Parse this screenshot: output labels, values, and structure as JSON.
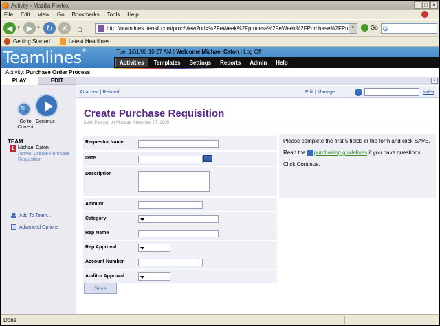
{
  "window": {
    "title": "Activity - Mozilla Firefox",
    "controls": [
      "_",
      "□",
      "×"
    ]
  },
  "menu": [
    "File",
    "Edit",
    "View",
    "Go",
    "Bookmarks",
    "Tools",
    "Help"
  ],
  "address": {
    "url": "http://teamlines.itensil.com/proc/view?uri=%2FeWeek%2Fprocess%2FeWeek%2FPurchase%2FPurchase%20Orc",
    "go_label": "Go",
    "search_glyph": "G"
  },
  "bookmarks": [
    "Getting Started",
    "Latest Headlines"
  ],
  "app": {
    "logo": "Teamlines",
    "logo_mark": "®",
    "datetime": "Tue, 1/31/06 10:27 AM",
    "welcome": "Welcome Michael Caton",
    "logoff": "Log Off",
    "nav": [
      "Activities",
      "Templates",
      "Settings",
      "Reports",
      "Admin",
      "Help"
    ],
    "activity_label": "Activity:",
    "activity_name": "Purchase Order Process"
  },
  "left": {
    "tabs": [
      "PLAY",
      "EDIT"
    ],
    "go_to_current": "Go to Current",
    "continue": "Continue",
    "team_header": "TEAM",
    "member_num": "1",
    "member_name": "Michael Caton",
    "member_status": "Active: Create Purchase Requisition",
    "add_to_team": "Add To Team...",
    "advanced_options": "Advanced Options"
  },
  "main": {
    "close_glyph": "×",
    "links_left": "Attached | Related",
    "links_right": "Edit | Manage",
    "index": "Index",
    "title": "Create Purchase Requisition",
    "subtitle": "Keith Pattison on Monday, November 07, 2005",
    "fields": {
      "requestor": "Requestor Name",
      "date": "Date",
      "description": "Description",
      "amount": "Amount",
      "category": "Category",
      "rep_name": "Rep Name",
      "rep_approval": "Rep Approval",
      "account_number": "Account Number",
      "auditor_approval": "Auditor Approval"
    },
    "help": {
      "line1": "Please complete the first 5 fields in the form and click SAVE.",
      "line2_pre": "Read the",
      "line2_link": "purchasing guidelines",
      "line2_post": "if you have questions.",
      "line3": "Click Continue."
    },
    "save": "Save"
  },
  "status": "Done"
}
